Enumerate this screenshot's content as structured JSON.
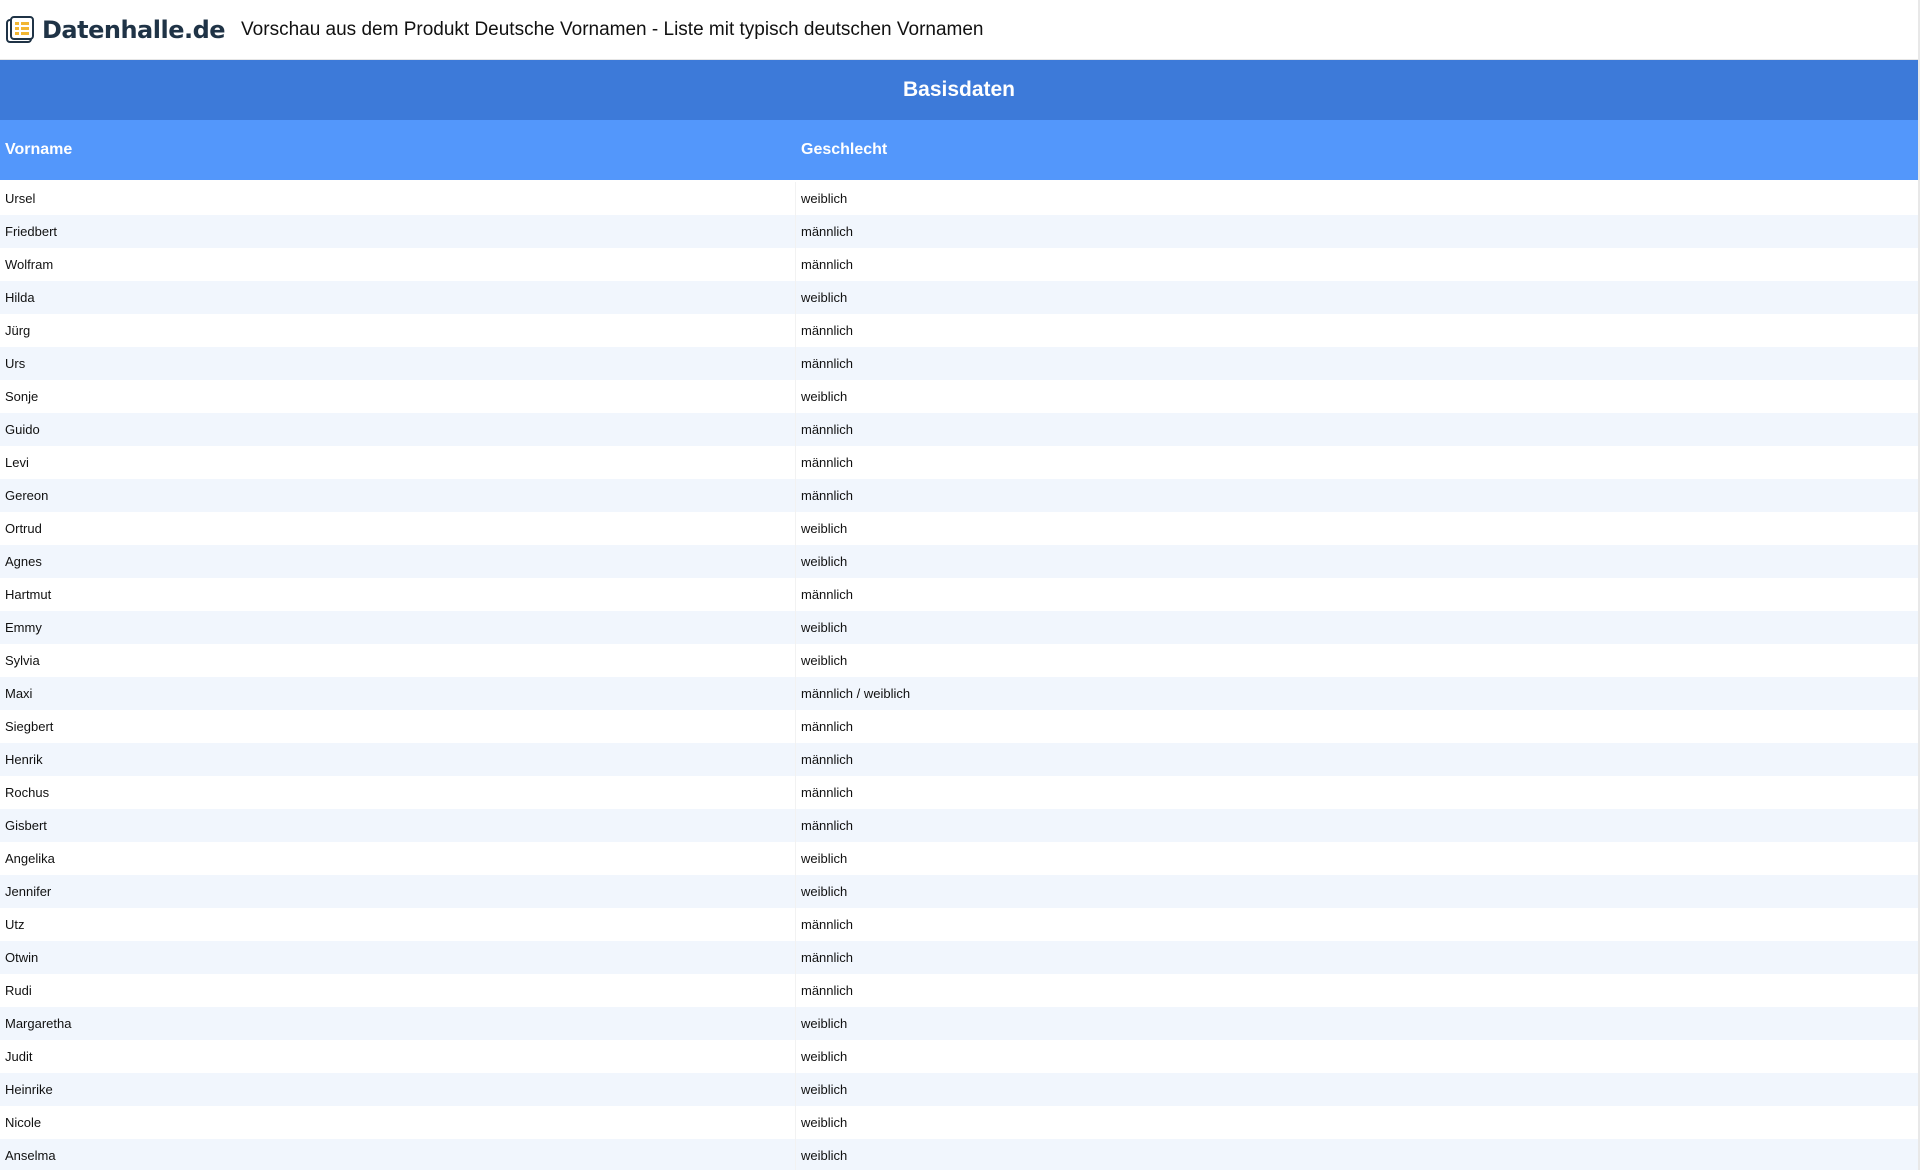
{
  "header": {
    "brand": "Datenhalle.de",
    "brand_icon": "database-logo-icon",
    "title": "Vorschau aus dem Produkt Deutsche Vornamen - Liste mit typisch deutschen Vornamen"
  },
  "section": {
    "title": "Basisdaten"
  },
  "table": {
    "columns": [
      "Vorname",
      "Geschlecht"
    ],
    "rows": [
      [
        "Ursel",
        "weiblich"
      ],
      [
        "Friedbert",
        "männlich"
      ],
      [
        "Wolfram",
        "männlich"
      ],
      [
        "Hilda",
        "weiblich"
      ],
      [
        "Jürg",
        "männlich"
      ],
      [
        "Urs",
        "männlich"
      ],
      [
        "Sonje",
        "weiblich"
      ],
      [
        "Guido",
        "männlich"
      ],
      [
        "Levi",
        "männlich"
      ],
      [
        "Gereon",
        "männlich"
      ],
      [
        "Ortrud",
        "weiblich"
      ],
      [
        "Agnes",
        "weiblich"
      ],
      [
        "Hartmut",
        "männlich"
      ],
      [
        "Emmy",
        "weiblich"
      ],
      [
        "Sylvia",
        "weiblich"
      ],
      [
        "Maxi",
        "männlich / weiblich"
      ],
      [
        "Siegbert",
        "männlich"
      ],
      [
        "Henrik",
        "männlich"
      ],
      [
        "Rochus",
        "männlich"
      ],
      [
        "Gisbert",
        "männlich"
      ],
      [
        "Angelika",
        "weiblich"
      ],
      [
        "Jennifer",
        "weiblich"
      ],
      [
        "Utz",
        "männlich"
      ],
      [
        "Otwin",
        "männlich"
      ],
      [
        "Rudi",
        "männlich"
      ],
      [
        "Margaretha",
        "weiblich"
      ],
      [
        "Judit",
        "weiblich"
      ],
      [
        "Heinrike",
        "weiblich"
      ],
      [
        "Nicole",
        "weiblich"
      ],
      [
        "Anselma",
        "weiblich"
      ]
    ]
  },
  "colors": {
    "section_header": "#3d7ad9",
    "column_header": "#5397fb",
    "row_alt": "#f1f6fd",
    "brand_text": "#1f3346",
    "logo_accent": "#f2b632"
  }
}
